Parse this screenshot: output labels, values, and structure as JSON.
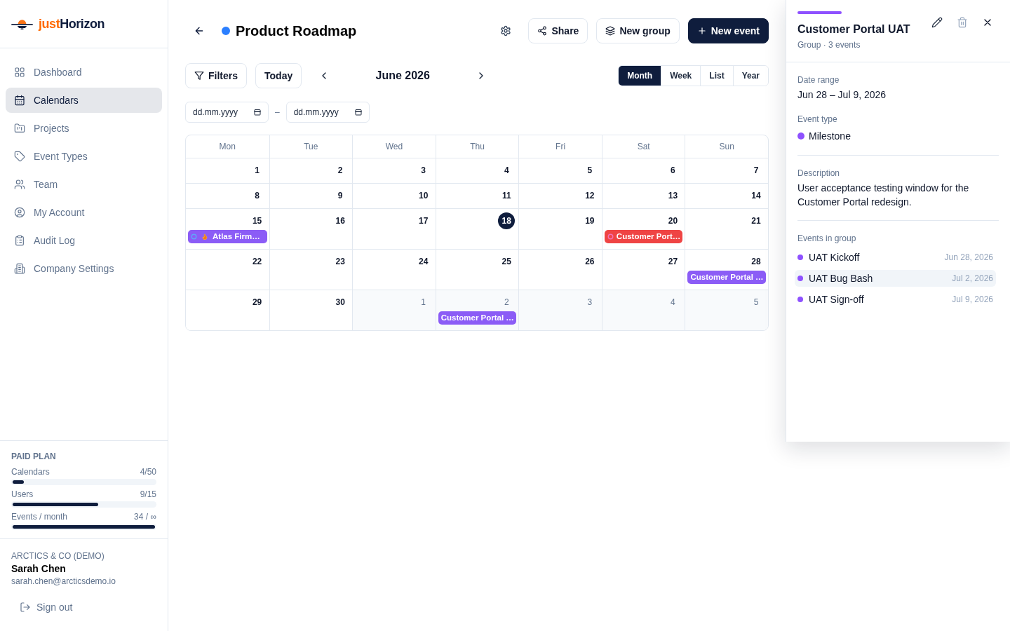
{
  "sidebar": {
    "brand": {
      "prefix": "just",
      "name": "Horizon"
    },
    "nav": [
      {
        "label": "Dashboard",
        "selected": false
      },
      {
        "label": "Calendars",
        "selected": true
      },
      {
        "label": "Projects",
        "selected": false
      },
      {
        "label": "Event Types",
        "selected": false
      },
      {
        "label": "Team",
        "selected": false
      },
      {
        "label": "My Account",
        "selected": false
      },
      {
        "label": "Audit Log",
        "selected": false
      },
      {
        "label": "Company Settings",
        "selected": false
      }
    ],
    "plan": {
      "title": "PAID PLAN",
      "meters": [
        {
          "label": "Calendars",
          "reading": "4/50",
          "level": 0.08
        },
        {
          "label": "Users",
          "reading": "9/15",
          "level": 0.6
        },
        {
          "label": "Events / month",
          "reading": "34 / ∞",
          "level": 1
        }
      ]
    },
    "account": {
      "organization": "ARCTICS & CO (DEMO)",
      "name": "Sarah Chen",
      "email": "sarah.chen@arcticsdemo.io",
      "sign_out": "Sign out"
    }
  },
  "header": {
    "title": "Product Roadmap",
    "actions": [
      {
        "label": "Share",
        "kind": "secondary"
      },
      {
        "label": "New group",
        "kind": "secondary"
      },
      {
        "label": "New event",
        "kind": "primary"
      }
    ]
  },
  "toolbar": {
    "filters": "Filters",
    "today": "Today",
    "period": "June 2026",
    "views": [
      {
        "label": "Month",
        "selected": true
      },
      {
        "label": "Week",
        "selected": false
      },
      {
        "label": "List",
        "selected": false
      },
      {
        "label": "Year",
        "selected": false
      }
    ],
    "date_from": {
      "placeholder": "dd.mm.yyyy"
    },
    "date_separator": "–",
    "date_to": {
      "placeholder": "dd.mm.yyyy"
    }
  },
  "calendar": {
    "weekdays": [
      "Mon",
      "Tue",
      "Wed",
      "Thu",
      "Fri",
      "Sat",
      "Sun"
    ],
    "weeks": [
      {
        "days": [
          {
            "day": "1",
            "in_month": true,
            "today": false
          },
          {
            "day": "2",
            "in_month": true,
            "today": false
          },
          {
            "day": "3",
            "in_month": true,
            "today": false
          },
          {
            "day": "4",
            "in_month": true,
            "today": false
          },
          {
            "day": "5",
            "in_month": true,
            "today": false
          },
          {
            "day": "6",
            "in_month": true,
            "today": false
          },
          {
            "day": "7",
            "in_month": true,
            "today": false
          }
        ]
      },
      {
        "days": [
          {
            "day": "8",
            "in_month": true,
            "today": false
          },
          {
            "day": "9",
            "in_month": true,
            "today": false
          },
          {
            "day": "10",
            "in_month": true,
            "today": false
          },
          {
            "day": "11",
            "in_month": true,
            "today": false
          },
          {
            "day": "12",
            "in_month": true,
            "today": false
          },
          {
            "day": "13",
            "in_month": true,
            "today": false
          },
          {
            "day": "14",
            "in_month": true,
            "today": false
          }
        ]
      },
      {
        "days": [
          {
            "day": "15",
            "in_month": true,
            "today": false,
            "events": [
              {
                "title": "Atlas Firm…",
                "color": "#8b5cf6",
                "marker": {
                  "color": "#60a5fa"
                },
                "flame": true
              }
            ]
          },
          {
            "day": "16",
            "in_month": true,
            "today": false
          },
          {
            "day": "17",
            "in_month": true,
            "today": false
          },
          {
            "day": "18",
            "in_month": true,
            "today": true
          },
          {
            "day": "19",
            "in_month": true,
            "today": false
          },
          {
            "day": "20",
            "in_month": true,
            "today": false,
            "events": [
              {
                "title": "Customer Port…",
                "color": "#ef4444",
                "marker": {
                  "color": "#f472b6"
                },
                "flame": false
              }
            ]
          },
          {
            "day": "21",
            "in_month": true,
            "today": false
          }
        ]
      },
      {
        "days": [
          {
            "day": "22",
            "in_month": true,
            "today": false
          },
          {
            "day": "23",
            "in_month": true,
            "today": false
          },
          {
            "day": "24",
            "in_month": true,
            "today": false
          },
          {
            "day": "25",
            "in_month": true,
            "today": false
          },
          {
            "day": "26",
            "in_month": true,
            "today": false
          },
          {
            "day": "27",
            "in_month": true,
            "today": false
          },
          {
            "day": "28",
            "in_month": true,
            "today": false,
            "events": [
              {
                "title": "Customer Portal …",
                "color": "#8b5cf6",
                "flame": false
              }
            ]
          }
        ]
      },
      {
        "days": [
          {
            "day": "29",
            "in_month": true,
            "today": false
          },
          {
            "day": "30",
            "in_month": true,
            "today": false
          },
          {
            "day": "1",
            "in_month": false,
            "today": false
          },
          {
            "day": "2",
            "in_month": false,
            "today": false,
            "events": [
              {
                "title": "Customer Portal …",
                "color": "#8b5cf6",
                "flame": false
              }
            ]
          },
          {
            "day": "3",
            "in_month": false,
            "today": false
          },
          {
            "day": "4",
            "in_month": false,
            "today": false
          },
          {
            "day": "5",
            "in_month": false,
            "today": false
          }
        ]
      }
    ]
  },
  "detail_panel": {
    "title": "Customer Portal UAT",
    "subtitle": "Group · 3 events",
    "fields": [
      {
        "label": "Date range",
        "value": "Jun 28 – Jul 9, 2026",
        "kind": "text"
      },
      {
        "label": "Event type",
        "value": "Milestone",
        "kind": "type"
      }
    ],
    "description": {
      "label": "Description",
      "text": "User acceptance testing window for the Customer Portal redesign."
    },
    "group_events": {
      "label": "Events in group",
      "items": [
        {
          "name": "UAT Kickoff",
          "date": "Jun 28, 2026",
          "selected": false
        },
        {
          "name": "UAT Bug Bash",
          "date": "Jul 2, 2026",
          "selected": true
        },
        {
          "name": "UAT Sign-off",
          "date": "Jul 9, 2026",
          "selected": false
        }
      ]
    }
  }
}
